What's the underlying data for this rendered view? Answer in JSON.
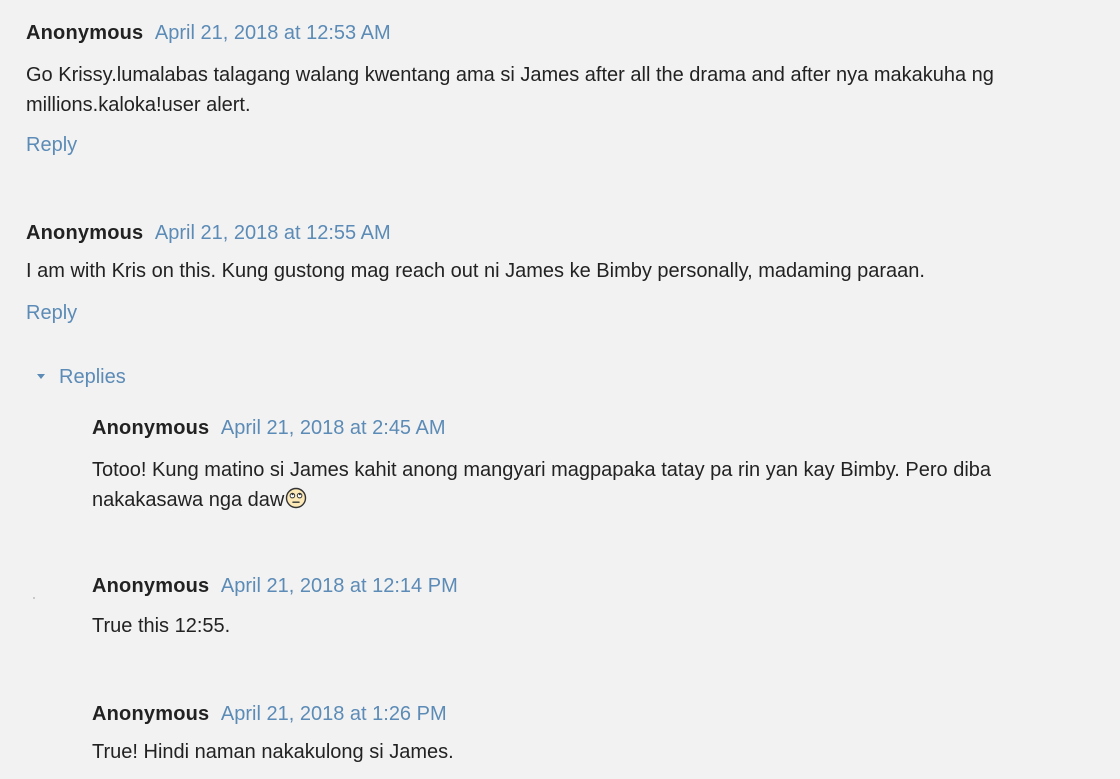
{
  "comments": [
    {
      "author": "Anonymous",
      "timestamp": "April 21, 2018 at 12:53 AM",
      "body": "Go Krissy.lumalabas talagang walang kwentang ama si James after all the drama and after nya makakuha ng millions.kaloka!user alert.",
      "reply_label": "Reply"
    },
    {
      "author": "Anonymous",
      "timestamp": "April 21, 2018 at 12:55 AM",
      "body": "I am with Kris on this. Kung gustong mag reach out ni James ke Bimby personally, madaming paraan.",
      "reply_label": "Reply",
      "replies_label": "Replies",
      "replies": [
        {
          "author": "Anonymous",
          "timestamp": "April 21, 2018 at 2:45 AM",
          "body": "Totoo! Kung matino si James kahit anong mangyari magpapaka tatay pa rin yan kay Bimby. Pero diba nakakasawa nga daw",
          "emoji": "rolling-eyes-emoji-icon"
        },
        {
          "author": "Anonymous",
          "timestamp": "April 21, 2018 at 12:14 PM",
          "body": "True this 12:55."
        },
        {
          "author": "Anonymous",
          "timestamp": "April 21, 2018 at 1:26 PM",
          "body": "True! Hindi naman nakakulong si James."
        }
      ]
    }
  ],
  "colors": {
    "background": "#f2f2f2",
    "text": "#222222",
    "link": "#5b8bb6"
  }
}
